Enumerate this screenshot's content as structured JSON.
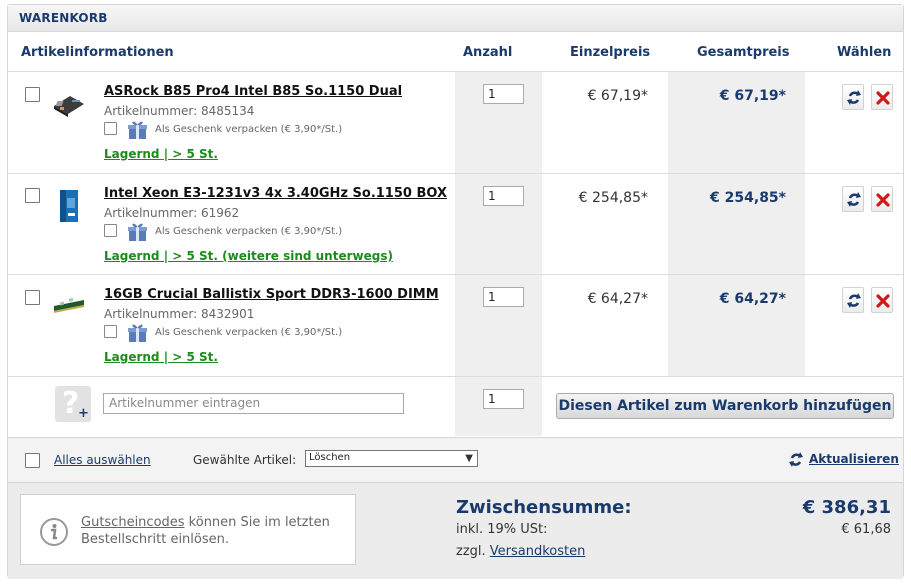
{
  "header": {
    "title": "WARENKORB"
  },
  "columns": {
    "info": "Artikelinformationen",
    "qty": "Anzahl",
    "unit_price": "Einzelpreis",
    "total_price": "Gesamtpreis",
    "select": "Wählen"
  },
  "items": [
    {
      "name": "ASRock B85 Pro4 Intel B85 So.1150 Dual",
      "artnr": "Artikelnummer: 8485134",
      "gift": "Als Geschenk verpacken (€ 3,90*/St.)",
      "stock": "Lagernd | > 5 St.",
      "qty": "1",
      "unit_price": "€ 67,19*",
      "total": "€ 67,19*",
      "thumb_icon": "motherboard-icon"
    },
    {
      "name": "Intel Xeon E3-1231v3 4x 3.40GHz So.1150 BOX",
      "artnr": "Artikelnummer: 61962",
      "gift": "Als Geschenk verpacken (€ 3,90*/St.)",
      "stock": "Lagernd | > 5 St. (weitere sind unterwegs)",
      "qty": "1",
      "unit_price": "€ 254,85*",
      "total": "€ 254,85*",
      "thumb_icon": "cpu-box-icon"
    },
    {
      "name": "16GB Crucial Ballistix Sport DDR3-1600 DIMM",
      "artnr": "Artikelnummer: 8432901",
      "gift": "Als Geschenk verpacken (€ 3,90*/St.)",
      "stock": "Lagernd | > 5 St.",
      "qty": "1",
      "unit_price": "€ 64,27*",
      "total": "€ 64,27*",
      "thumb_icon": "ram-module-icon"
    }
  ],
  "add_row": {
    "placeholder": "Artikelnummer eintragen",
    "qty": "1",
    "button": "Diesen Artikel zum Warenkorb hinzufügen"
  },
  "toolbar": {
    "select_all": "Alles auswählen",
    "selected_label": "Gewählte Artikel:",
    "action_value": "Löschen",
    "refresh": "Aktualisieren"
  },
  "footer": {
    "voucher_link": "Gutscheincodes",
    "voucher_text": " können Sie im letzten Bestellschritt einlösen.",
    "subtotal_label": "Zwischensumme:",
    "subtotal_value": "€ 386,31",
    "vat_label": "inkl. 19% USt:",
    "vat_value": "€ 61,68",
    "shipping_prefix": "zzgl. ",
    "shipping_link": "Versandkosten"
  },
  "colors": {
    "brand": "#1a3a6b",
    "stock_green": "#1e8a1e",
    "delete_red": "#d01818"
  }
}
